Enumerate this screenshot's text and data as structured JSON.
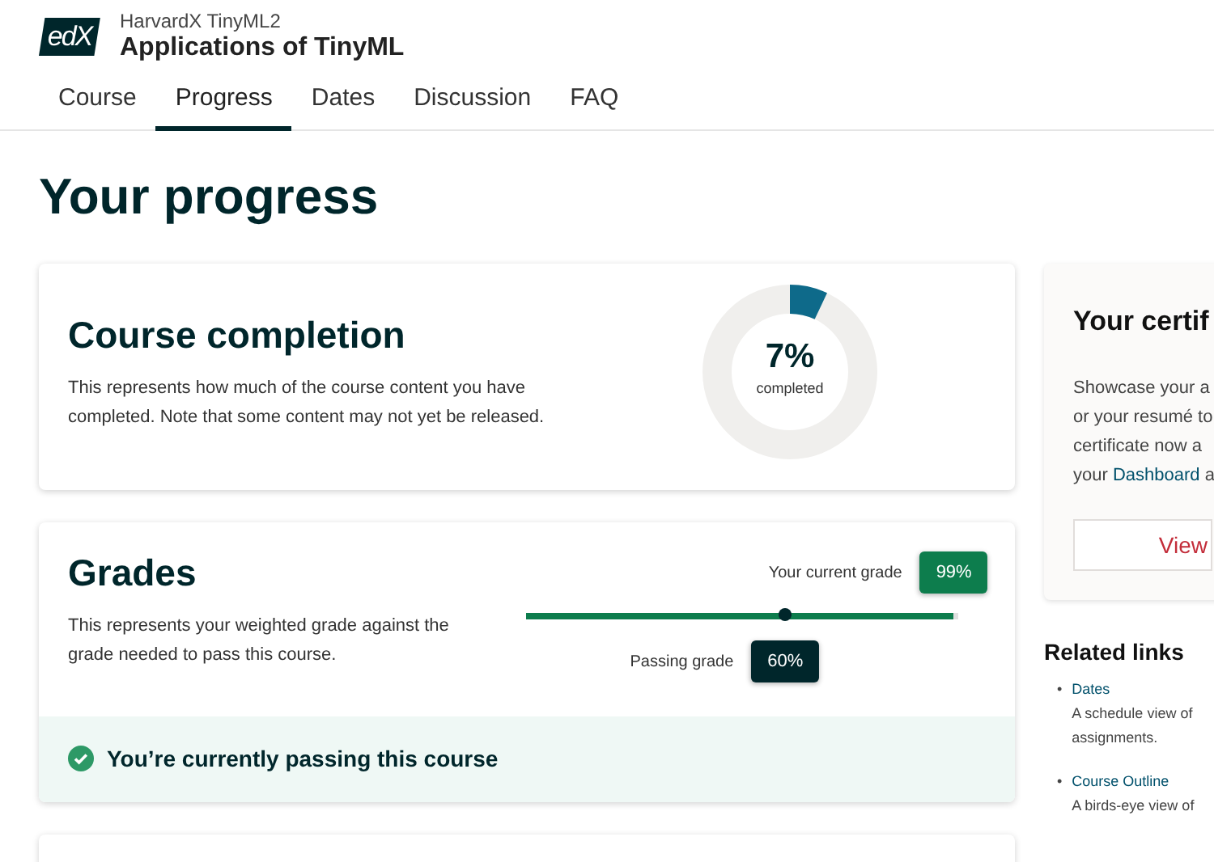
{
  "header": {
    "logo": "edX",
    "org_course": "HarvardX TinyML2",
    "title": "Applications of TinyML"
  },
  "tabs": [
    {
      "label": "Course",
      "selected": false
    },
    {
      "label": "Progress",
      "selected": true
    },
    {
      "label": "Dates",
      "selected": false
    },
    {
      "label": "Discussion",
      "selected": false
    },
    {
      "label": "FAQ",
      "selected": false
    }
  ],
  "page_title": "Your progress",
  "completion": {
    "title": "Course completion",
    "description": "This represents how much of the course content you have completed. Note that some content may not yet be released.",
    "percent": "7%",
    "caption": "completed",
    "level": 0.07
  },
  "grades": {
    "title": "Grades",
    "description": "This represents your weighted grade against the grade needed to pass this course.",
    "current_label": "Your current grade",
    "current_value": "99%",
    "current": {
      "level": 0.99
    },
    "passing_label": "Passing grade",
    "passing_value": "60%",
    "passing": {
      "level": 0.6
    },
    "status": "You’re currently passing this course",
    "passing_now": true
  },
  "certificate": {
    "title": "Your certif",
    "lines": [
      "Showcase your a",
      "or your resumé to",
      "certificate now a"
    ],
    "last_line": {
      "before": "your ",
      "link": "Dashboard",
      "after": " a"
    },
    "button": "View"
  },
  "related_links": {
    "title": "Related links",
    "items": [
      {
        "bullet": "•",
        "label": "Dates",
        "description": [
          "A schedule view of",
          "assignments."
        ]
      },
      {
        "bullet": "•",
        "label": "Course Outline",
        "description": [
          "A birds-eye view of"
        ]
      }
    ]
  }
}
